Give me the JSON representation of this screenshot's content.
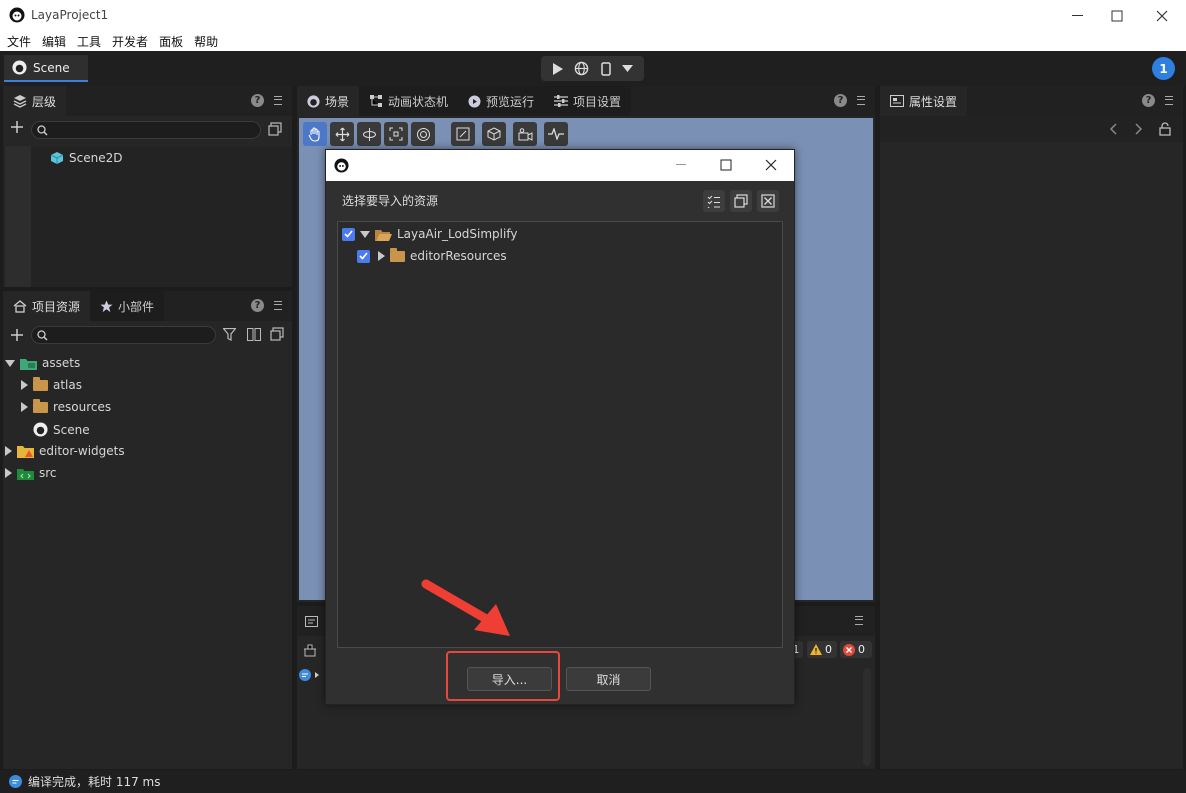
{
  "window": {
    "title": "LayaProject1"
  },
  "menu": [
    "文件",
    "编辑",
    "工具",
    "开发者",
    "面板",
    "帮助"
  ],
  "doc_tab": {
    "label": "Scene"
  },
  "notification_count": "1",
  "hierarchy": {
    "tab": "层级",
    "items": [
      {
        "label": "Scene2D"
      }
    ]
  },
  "scene_tabs": [
    {
      "label": "场景"
    },
    {
      "label": "动画状态机"
    },
    {
      "label": "预览运行"
    },
    {
      "label": "项目设置"
    }
  ],
  "inspector": {
    "tab": "属性设置"
  },
  "assets_panel": {
    "tabs": [
      {
        "label": "项目资源"
      },
      {
        "label": "小部件"
      }
    ],
    "tree": [
      {
        "label": "assets"
      },
      {
        "label": "atlas"
      },
      {
        "label": "resources"
      },
      {
        "label": "Scene"
      },
      {
        "label": "editor-widgets"
      },
      {
        "label": "src"
      }
    ]
  },
  "console": {
    "warn_count": "0",
    "error_count": "0",
    "info_count": "1"
  },
  "dialog": {
    "heading": "选择要导入的资源",
    "tree": [
      {
        "label": "LayaAir_LodSimplify",
        "checked": true,
        "expanded": true
      },
      {
        "label": "editorResources",
        "checked": true,
        "expanded": false
      }
    ],
    "import_label": "导入...",
    "cancel_label": "取消"
  },
  "status": {
    "text": "编译完成，耗时 117 ms"
  },
  "colors": {
    "accent": "#3d7fd9",
    "highlight_box": "#e8473c",
    "arrow": "#ef3f35",
    "checkbox": "#4a7cf0",
    "scene_bg": "#7a90b4"
  }
}
